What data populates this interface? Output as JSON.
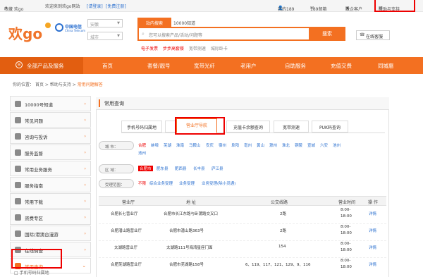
{
  "topbar": {
    "fav": "收藏 欢go",
    "welcome": "欢迎来到欢go网站",
    "login": "[请登录]",
    "register": "[免费注册]",
    "mine": "我的189",
    "mail": "189邮箱",
    "corp": "政企客户",
    "help": "帮助与支持"
  },
  "header": {
    "logo_text": "欢go",
    "brand": "中国电信",
    "brand_en": "China Telecom",
    "province": "安徽",
    "city": "城市",
    "search_tab_active": "站内搜索",
    "search_tab_other": "10000知道",
    "search_placeholder": "您可以搜索产品/活动/问题等",
    "search_button": "搜索",
    "hot_links": [
      "电子发票",
      "步步高套餐",
      "宽带测速",
      "城际卧卡"
    ],
    "service_label": "在线客服"
  },
  "nav": {
    "all_products": "全部产品及服务",
    "items": [
      "首页",
      "套餐/靓号",
      "宽带光纤",
      "老用户",
      "自助服务",
      "充值交费",
      "同城惠"
    ]
  },
  "breadcrumb": {
    "prefix": "你的位置：",
    "home": "首页",
    "sep": ">",
    "section": "帮助与支持",
    "current": "常用问题解答"
  },
  "sidebar": {
    "items": [
      "10000号知道",
      "常见问题",
      "咨询与投诉",
      "服务监督",
      "常用业务服务",
      "服务指南",
      "常用下载",
      "资费专区",
      "国际/港澳台漫游",
      "在线调查",
      "常用查询"
    ],
    "sub_item": "手机号码归属地"
  },
  "main": {
    "title": "常用查询",
    "tabs": [
      "手机号码归属地",
      "城市区号",
      "营业厅导航",
      "充值卡余额查询",
      "宽带测速",
      "PUK码查询"
    ],
    "city_label": "城 市：",
    "cities_row1": [
      "合肥",
      "蚌埠",
      "芜湖",
      "淮南",
      "马鞍山",
      "安庆",
      "宿州",
      "阜阳",
      "亳州",
      "黄山",
      "滁州",
      "淮北",
      "铜陵",
      "宣城",
      "六安",
      "池州"
    ],
    "cities_row2": [
      "池州"
    ],
    "district_label": "区 域：",
    "districts": [
      "合肥市",
      "肥东县",
      "肥西县",
      "长丰县",
      "庐江县"
    ],
    "scope_label": "受理范围：",
    "scopes": [
      "不限",
      "综合业务受理",
      "业务受理",
      "业务受理(除小灵通)"
    ],
    "table": {
      "headers": [
        "营业厅",
        "地 址",
        "公交线路",
        "营业时间",
        "操 作"
      ],
      "rows": [
        {
          "name": "合肥长七营业厅",
          "addr": "合肥市长江东路与卧蒲路交叉口",
          "bus": "2路",
          "time1": "8:00-",
          "time2": "18:00",
          "op": "详情"
        },
        {
          "name": "合肥潜山路营业厅",
          "addr": "合肥市潜山路363号",
          "bus": "2路",
          "time1": "8:00-",
          "time2": "18:00",
          "op": "详情"
        },
        {
          "name": "太湖路营业厅",
          "addr": "太湖路111号海湾星座门面",
          "bus": "154",
          "time1": "8:00-",
          "time2": "18:00",
          "op": "详情"
        },
        {
          "name": "合肥芜湖路营业厅",
          "addr": "合肥市芜湖路158号",
          "bus": "6、119、117、121、129、9、116",
          "time1": "8:00-",
          "time2": "18:00",
          "op": "详情"
        }
      ]
    }
  },
  "colors": {
    "brand_orange": "#f37021",
    "link_blue": "#2a6fcf",
    "highlight_red": "#e00000"
  }
}
